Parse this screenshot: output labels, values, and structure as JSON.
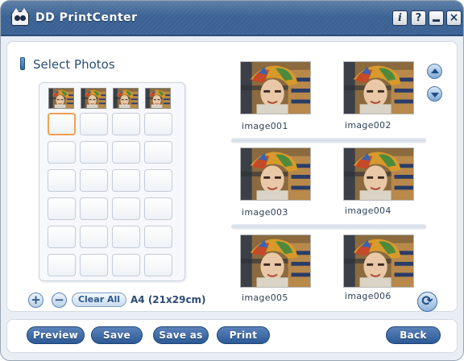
{
  "window": {
    "title": "DD PrintCenter"
  },
  "titlebar_buttons": {
    "info": "i",
    "help": "?",
    "close": "×"
  },
  "left_panel": {
    "title": "Select Photos",
    "add_symbol": "+",
    "remove_symbol": "−",
    "clear_all": "Clear All",
    "paper_size": "A4 (21x29cm)"
  },
  "photos": [
    {
      "label": "image001"
    },
    {
      "label": "image002"
    },
    {
      "label": "image003"
    },
    {
      "label": "image004"
    },
    {
      "label": "image005"
    },
    {
      "label": "image006"
    }
  ],
  "refresh_symbol": "⟳",
  "bottom_bar": {
    "preview": "Preview",
    "save": "Save",
    "save_as": "Save as",
    "print": "Print",
    "back": "Back"
  },
  "colors": {
    "title_bar": "#3f6797",
    "accent": "#2c5a95",
    "selection_border": "#f0a050"
  },
  "icons": [
    "app-logo-icon",
    "info-icon",
    "help-icon",
    "minimize-icon",
    "close-icon",
    "scroll-up-icon",
    "scroll-down-icon",
    "refresh-icon",
    "plus-icon",
    "minus-icon"
  ]
}
